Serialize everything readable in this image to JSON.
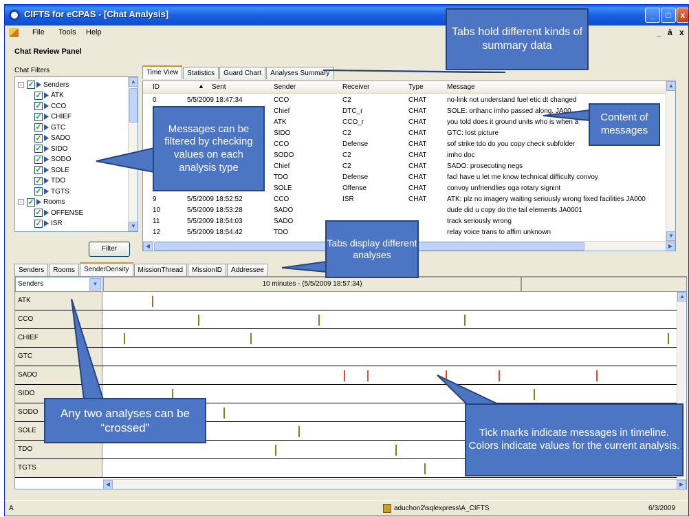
{
  "window": {
    "title": "CIFTS for eCPAS - [Chat Analysis]"
  },
  "menu": [
    "File",
    "Tools",
    "Help"
  ],
  "window_controls": {
    "minimize": "_",
    "maximize": "□",
    "close": "x",
    "child_minimize": "_",
    "child_restore": "ā",
    "child_close": "x"
  },
  "panel": {
    "title": "Chat Review Panel",
    "filters_label": "Chat Filters"
  },
  "tree": [
    {
      "label": "Senders",
      "level": 0,
      "expander": "-"
    },
    {
      "label": "ATK",
      "level": 1
    },
    {
      "label": "CCO",
      "level": 1
    },
    {
      "label": "CHIEF",
      "level": 1
    },
    {
      "label": "GTC",
      "level": 1
    },
    {
      "label": "SADO",
      "level": 1
    },
    {
      "label": "SIDO",
      "level": 1
    },
    {
      "label": "SODO",
      "level": 1
    },
    {
      "label": "SOLE",
      "level": 1
    },
    {
      "label": "TDO",
      "level": 1
    },
    {
      "label": "TGTS",
      "level": 1
    },
    {
      "label": "Rooms",
      "level": 0,
      "expander": "-"
    },
    {
      "label": "OFFENSE",
      "level": 1
    },
    {
      "label": "ISR",
      "level": 1
    }
  ],
  "filter_button": "Filter",
  "top_tabs": [
    "Time View",
    "Statistics",
    "Guard Chart",
    "Analyses Summary"
  ],
  "columns": {
    "id": "ID",
    "sent": "Sent",
    "sender": "Sender",
    "receiver": "Receiver",
    "type": "Type",
    "message": "Message"
  },
  "messages": [
    {
      "id": "0",
      "sent": "5/5/2009 18:47:34",
      "sender": "CCO",
      "receiver": "C2",
      "type": "CHAT",
      "message": "no-link not understand fuel etic dt changed"
    },
    {
      "id": "",
      "sent": "",
      "sender": "Chief",
      "receiver": "DTC_r",
      "type": "CHAT",
      "message": "SOLE: orthanc imho passed along. JA00"
    },
    {
      "id": "",
      "sent": "",
      "sender": "ATK",
      "receiver": "CCO_r",
      "type": "CHAT",
      "message": "you told does it ground units who is when a"
    },
    {
      "id": "",
      "sent": "",
      "sender": "SIDO",
      "receiver": "C2",
      "type": "CHAT",
      "message": "GTC: lost picture"
    },
    {
      "id": "",
      "sent": "",
      "sender": "CCO",
      "receiver": "Defense",
      "type": "CHAT",
      "message": "sof strike tdo do you copy check subfolder"
    },
    {
      "id": "",
      "sent": "",
      "sender": "SODO",
      "receiver": "C2",
      "type": "CHAT",
      "message": "imho doc"
    },
    {
      "id": "",
      "sent": "",
      "sender": "Chief",
      "receiver": "C2",
      "type": "CHAT",
      "message": "SADO: prosecuting negs"
    },
    {
      "id": "",
      "sent": "",
      "sender": "TDO",
      "receiver": "Defense",
      "type": "CHAT",
      "message": "facl have u let me know technical difficulty convoy"
    },
    {
      "id": "",
      "sent": "",
      "sender": "SOLE",
      "receiver": "Offense",
      "type": "CHAT",
      "message": "convoy unfriendlies oga rotary signint"
    },
    {
      "id": "9",
      "sent": "5/5/2009 18:52:52",
      "sender": "CCO",
      "receiver": "ISR",
      "type": "CHAT",
      "message": "ATK: plz no imagery waiting seriously wrong fixed facilities JA000"
    },
    {
      "id": "10",
      "sent": "5/5/2009 18:53:28",
      "sender": "SADO",
      "receiver": "",
      "type": "",
      "message": "dude did u copy do the tail elements JA0001"
    },
    {
      "id": "11",
      "sent": "5/5/2009 18:54:03",
      "sender": "SADO",
      "receiver": "",
      "type": "",
      "message": "track seriously wrong"
    },
    {
      "id": "12",
      "sent": "5/5/2009 18:54:42",
      "sender": "TDO",
      "receiver": "",
      "type": "",
      "message": "relay voice trans to affim unknown"
    }
  ],
  "bottom_tabs": [
    "Senders",
    "Rooms",
    "SenderDensity",
    "MissionThread",
    "MissionID",
    "Addressee"
  ],
  "density": {
    "selector": "Senders",
    "timestamp": "10 minutes - (5/5/2009 18:57:34)",
    "colors": {
      "green": "#6a8e1c",
      "red": "#e8482a"
    },
    "rows": [
      {
        "label": "ATK",
        "ticks": [
          {
            "t": 0.085,
            "c": "green"
          }
        ]
      },
      {
        "label": "CCO",
        "ticks": [
          {
            "t": 0.165,
            "c": "green"
          },
          {
            "t": 0.375,
            "c": "green"
          },
          {
            "t": 0.63,
            "c": "green"
          }
        ]
      },
      {
        "label": "CHIEF",
        "ticks": [
          {
            "t": 0.036,
            "c": "green"
          },
          {
            "t": 0.257,
            "c": "green"
          },
          {
            "t": 0.985,
            "c": "green"
          }
        ]
      },
      {
        "label": "GTC",
        "ticks": []
      },
      {
        "label": "SADO",
        "ticks": [
          {
            "t": 0.42,
            "c": "red"
          },
          {
            "t": 0.46,
            "c": "red"
          },
          {
            "t": 0.597,
            "c": "red"
          },
          {
            "t": 0.69,
            "c": "red"
          },
          {
            "t": 0.86,
            "c": "red"
          }
        ]
      },
      {
        "label": "SIDO",
        "ticks": [
          {
            "t": 0.12,
            "c": "green"
          },
          {
            "t": 0.75,
            "c": "green"
          }
        ]
      },
      {
        "label": "SODO",
        "ticks": [
          {
            "t": 0.21,
            "c": "green"
          }
        ]
      },
      {
        "label": "SOLE",
        "ticks": [
          {
            "t": 0.34,
            "c": "green"
          }
        ]
      },
      {
        "label": "TDO",
        "ticks": [
          {
            "t": 0.3,
            "c": "green"
          },
          {
            "t": 0.51,
            "c": "green"
          }
        ]
      },
      {
        "label": "TGTS",
        "ticks": [
          {
            "t": 0.56,
            "c": "green"
          }
        ]
      }
    ]
  },
  "status": {
    "left": "A",
    "db": "aduchon2\\sqlexpress\\A_CIFTS",
    "date": "6/3/2009"
  },
  "callouts": {
    "tabs_summary": "Tabs hold different kinds of summary data",
    "filter": "Messages can be filtered by checking values on each analysis type",
    "content": "Content of messages",
    "tabs_analyses": "Tabs display different analyses",
    "crossed": "Any two analyses can be “crossed”",
    "ticks": "Tick marks indicate messages in timeline.  Colors indicate values for the current analysis."
  }
}
